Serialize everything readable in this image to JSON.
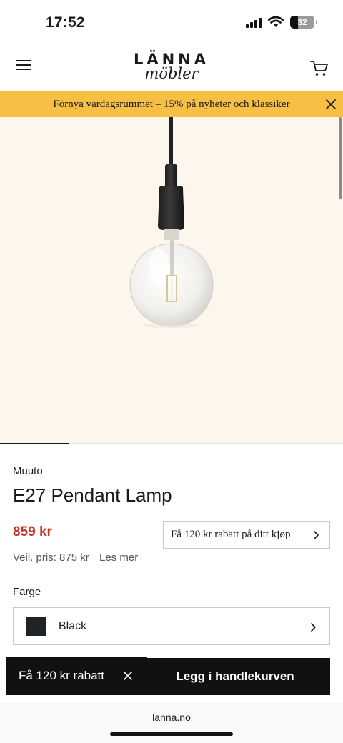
{
  "status_bar": {
    "time": "17:52",
    "battery": "32",
    "battery_level_percent": 32,
    "icons": [
      "signal-icon",
      "wifi-icon",
      "battery-icon"
    ]
  },
  "header": {
    "logo_top": "LÄNNA",
    "logo_bottom": "möbler",
    "menu_icon": "hamburger-menu-icon",
    "cart_icon": "shopping-cart-icon"
  },
  "promo": {
    "text": "Förnya vardagsrummet – 15% på nyheter och klassiker",
    "background": "#f7c045",
    "close_icon": "close-icon"
  },
  "product_image": {
    "background": "#fcf6ed",
    "description_icon": "pendant-lamp-image"
  },
  "carousel": {
    "current_index": 1,
    "total": 5
  },
  "product": {
    "brand": "Muuto",
    "title": "E27 Pendant Lamp",
    "price": "859 kr",
    "price_color": "#c0392b",
    "discount_button": "Få 120 kr rabatt på ditt kjøp",
    "rrp": "Veil. pris: 875 kr",
    "read_more": "Les mer"
  },
  "color": {
    "label": "Farge",
    "selected": "Black",
    "swatch_color": "#1f2326"
  },
  "bottom_bar": {
    "toast_text": "Få 120 kr rabatt",
    "add_to_cart": "Legg i handlekurven"
  },
  "browser": {
    "url": "lanna.no"
  }
}
